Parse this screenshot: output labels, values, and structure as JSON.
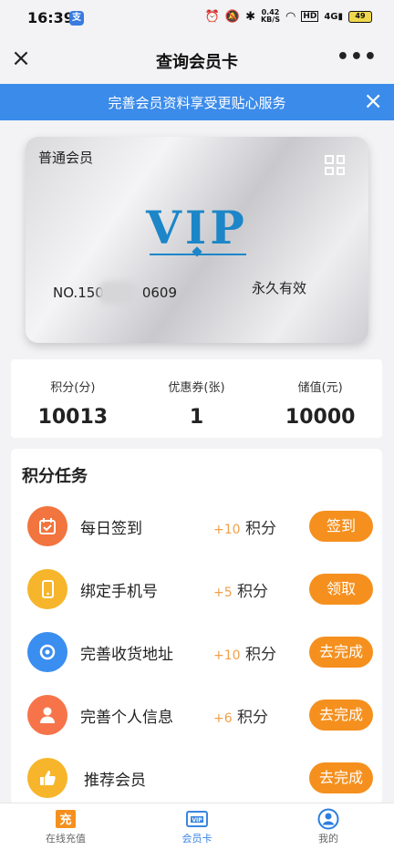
{
  "status_bar": {
    "time": "16:39",
    "net_speed_value": "0.42",
    "net_speed_unit": "KB/S",
    "battery": "49"
  },
  "nav": {
    "title": "查询会员卡"
  },
  "banner": {
    "text": "完善会员资料享受更贴心服务"
  },
  "card": {
    "level": "普通会员",
    "brand": "VIP",
    "number_prefix": "NO.150",
    "number_suffix": "0609",
    "validity": "永久有效"
  },
  "stats": [
    {
      "label": "积分(分)",
      "value": "10013"
    },
    {
      "label": "优惠券(张)",
      "value": "1"
    },
    {
      "label": "储值(元)",
      "value": "10000"
    }
  ],
  "tasks": {
    "title": "积分任务",
    "items": [
      {
        "name": "每日签到",
        "points": "+10",
        "unit": "积分",
        "button": "签到",
        "icon": "calendar-icon",
        "color": "#f2743e"
      },
      {
        "name": "绑定手机号",
        "points": "+5",
        "unit": "积分",
        "button": "领取",
        "icon": "phone-icon",
        "color": "#f6b52a"
      },
      {
        "name": "完善收货地址",
        "points": "+10",
        "unit": "积分",
        "button": "去完成",
        "icon": "location-icon",
        "color": "#3a8ef0"
      },
      {
        "name": "完善个人信息",
        "points": "+6",
        "unit": "积分",
        "button": "去完成",
        "icon": "user-icon",
        "color": "#f7744a"
      },
      {
        "name": "推荐会员",
        "points": "",
        "unit": "",
        "button": "去完成",
        "icon": "thumbs-up-icon",
        "color": "#f6b52a"
      }
    ]
  },
  "tab_bar": {
    "items": [
      {
        "label": "在线充值",
        "icon": "recharge-icon"
      },
      {
        "label": "会员卡",
        "icon": "vip-card-icon"
      },
      {
        "label": "我的",
        "icon": "profile-icon"
      }
    ]
  },
  "colors": {
    "accent_blue": "#3b8bea",
    "button_orange": "#f5901e",
    "points_orange": "#f0a04a"
  }
}
